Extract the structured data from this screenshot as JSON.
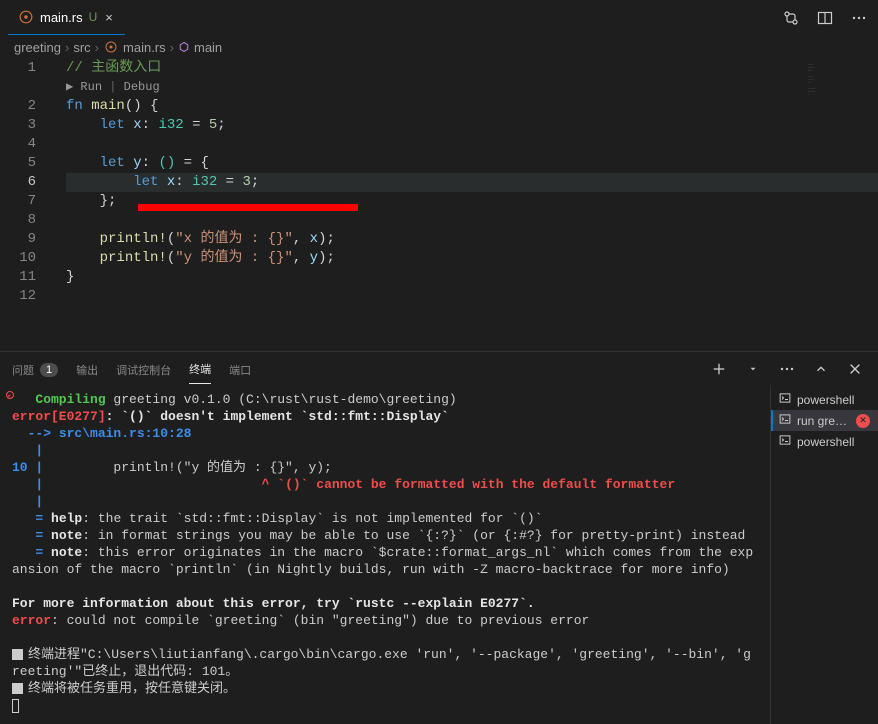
{
  "tab": {
    "filename": "main.rs",
    "modified_marker": "U",
    "close_label": "×"
  },
  "breadcrumbs": {
    "item0": "greeting",
    "item1": "src",
    "item2": "main.rs",
    "item3": "main"
  },
  "codelens": {
    "run": "▶ Run",
    "sep": " | ",
    "debug": "Debug"
  },
  "code": {
    "line1_comment": "// 主函数入口",
    "line2_fn": "fn",
    "line2_name": "main",
    "line2_rest": "() {",
    "line3_let": "let",
    "line3_var": "x",
    "line3_type": "i32",
    "line3_eq": " = ",
    "line3_val": "5",
    "line3_semi": ";",
    "line5_let": "let",
    "line5_var": "y",
    "line5_type": "()",
    "line5_rest": " = {",
    "line6_let": "let",
    "line6_var": "x",
    "line6_type": "i32",
    "line6_val": "3",
    "line7_close": "};",
    "line9_macro": "println!",
    "line9_str": "\"x 的值为 : {}\"",
    "line9_arg": "x",
    "line10_macro": "println!",
    "line10_str": "\"y 的值为 : {}\"",
    "line10_arg": "y",
    "line11_brace": "}"
  },
  "line_numbers": [
    "1",
    "2",
    "3",
    "4",
    "5",
    "6",
    "7",
    "8",
    "9",
    "10",
    "11",
    "12"
  ],
  "panel_tabs": {
    "problems": "问题",
    "problems_count": "1",
    "output": "输出",
    "debug_console": "调试控制台",
    "terminal": "终端",
    "ports": "端口"
  },
  "terminal": {
    "compiling": "Compiling",
    "compiling_rest": " greeting v0.1.0 (C:\\rust\\rust-demo\\greeting)",
    "error_code": "error[E0277]",
    "error_msg": ": `()` doesn't implement `std::fmt::Display`",
    "arrow": "  --> src\\main.rs:10:28",
    "pipe1": "   |",
    "line_no": "10 ",
    "pipe2": "|",
    "line_src": "         println!(\"y 的值为 : {}\", y);",
    "pipe3": "   |",
    "caret": "                            ^ ",
    "caret_msg": "`()` cannot be formatted with the default formatter",
    "pipe4": "   |",
    "help_eq": "   = ",
    "help_label": "help",
    "help_msg": ": the trait `std::fmt::Display` is not implemented for `()`",
    "note1_label": "note",
    "note1_msg": ": in format strings you may be able to use `{:?}` (or {:#?} for pretty-print) instead",
    "note2_label": "note",
    "note2_msg": ": this error originates in the macro `$crate::format_args_nl` which comes from the expansion of the macro `println` (in Nightly builds, run with -Z macro-backtrace for more info)",
    "more_info": "For more information about this error, try `rustc --explain E0277`.",
    "error2_label": "error",
    "error2_msg": ": could not compile `greeting` (bin \"greeting\") due to previous error",
    "proc_msg1": "终端进程\"C:\\Users\\liutianfang\\.cargo\\bin\\cargo.exe 'run', '--package', 'greeting', '--bin', 'greeting'\"已终止，退出代码: 101。",
    "proc_msg2": "终端将被任务重用，按任意键关闭。"
  },
  "terminal_list": {
    "item0": "powershell",
    "item1": "run gree…",
    "item2": "powershell"
  }
}
